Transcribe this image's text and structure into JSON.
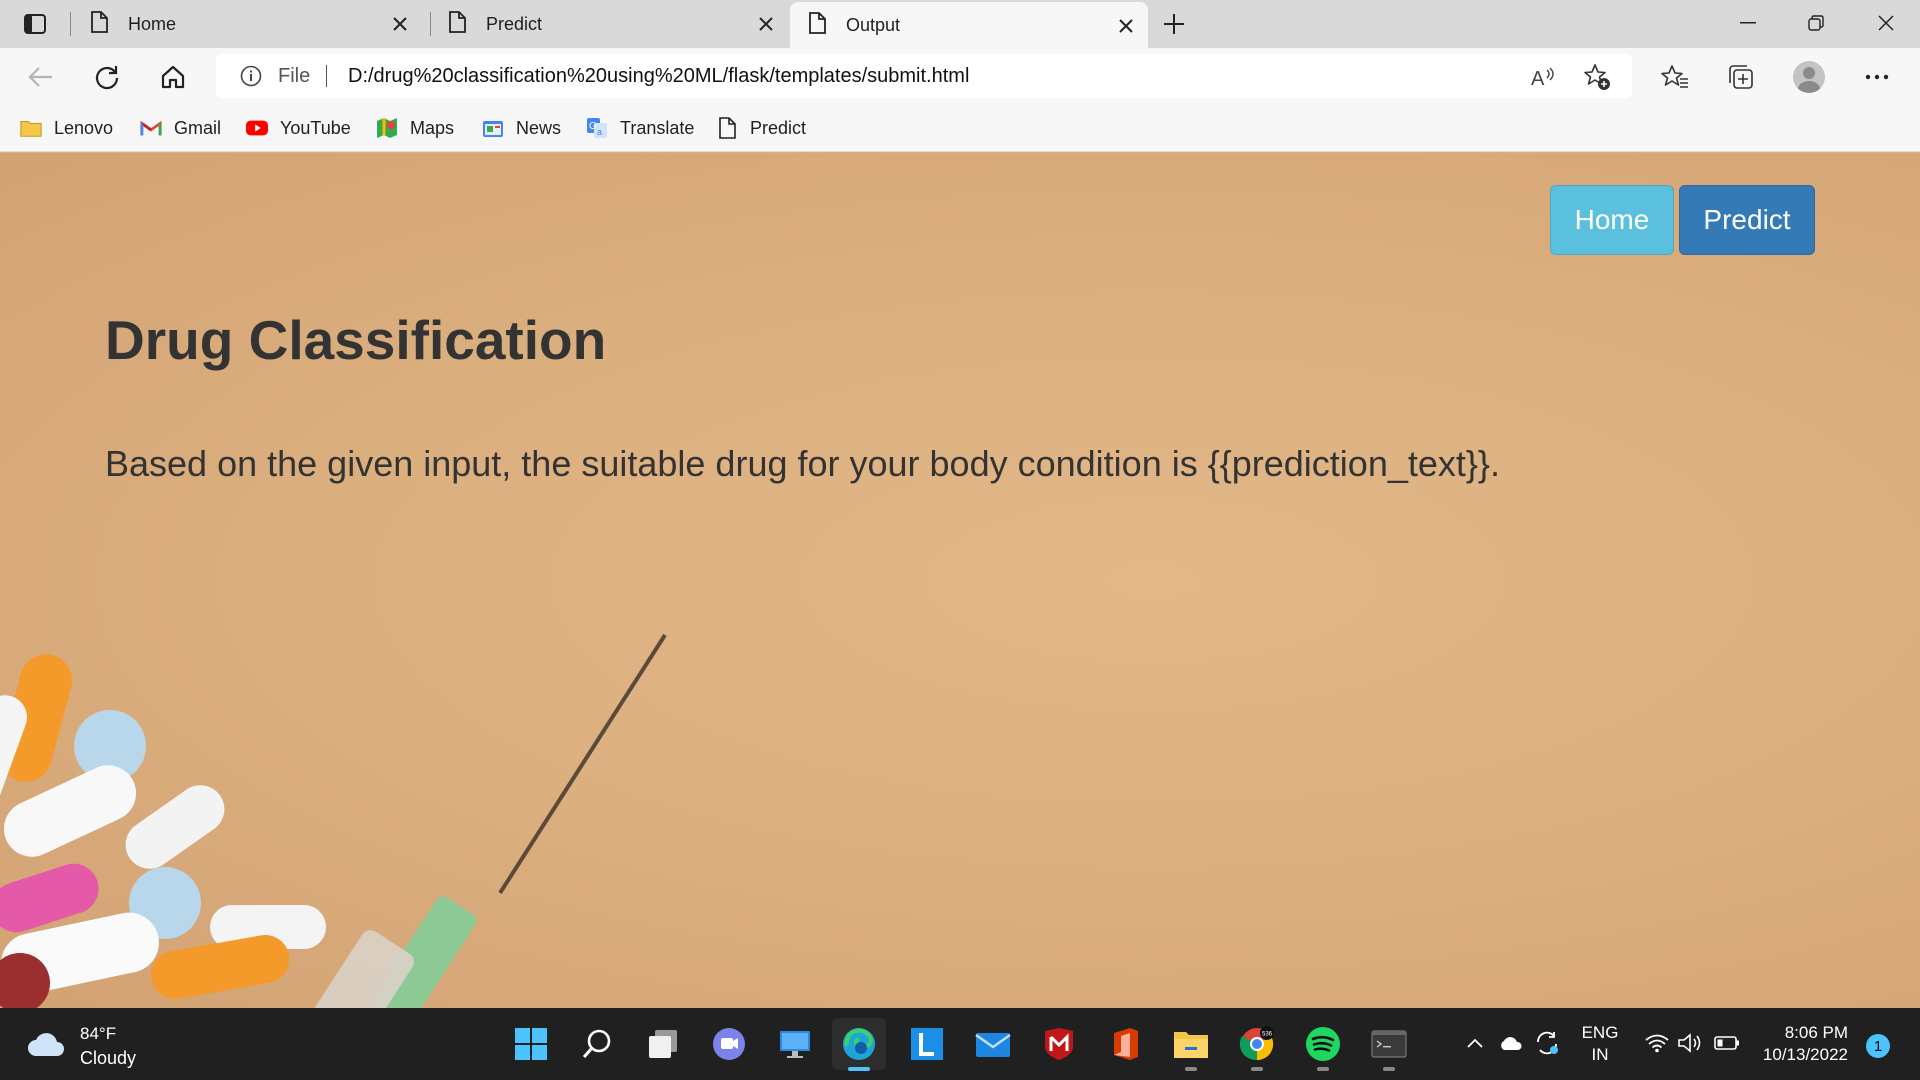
{
  "browser": {
    "tabs": [
      {
        "label": "Home",
        "active": false
      },
      {
        "label": "Predict",
        "active": false
      },
      {
        "label": "Output",
        "active": true
      }
    ],
    "address": {
      "scheme_label": "File",
      "url": "D:/drug%20classification%20using%20ML/flask/templates/submit.html"
    },
    "bookmarks": [
      {
        "label": "Lenovo",
        "icon": "folder-icon"
      },
      {
        "label": "Gmail",
        "icon": "gmail-icon"
      },
      {
        "label": "YouTube",
        "icon": "youtube-icon"
      },
      {
        "label": "Maps",
        "icon": "maps-icon"
      },
      {
        "label": "News",
        "icon": "news-icon"
      },
      {
        "label": "Translate",
        "icon": "translate-icon"
      },
      {
        "label": "Predict",
        "icon": "page-icon"
      }
    ]
  },
  "page": {
    "nav": {
      "home_label": "Home",
      "predict_label": "Predict"
    },
    "title": "Drug Classification",
    "result_text": "Based on the given input, the suitable drug for your body condition is {{prediction_text}}.",
    "colors": {
      "background": "#dbae7e",
      "home_button": "#5bc0de",
      "predict_button": "#337ab7",
      "text": "#333333"
    }
  },
  "taskbar": {
    "weather": {
      "temp": "84°F",
      "condition": "Cloudy"
    },
    "apps": [
      "start-icon",
      "search-icon",
      "task-view-icon",
      "teams-chat-icon",
      "remote-desktop-icon",
      "edge-icon",
      "lenovo-vantage-icon",
      "mail-icon",
      "mcafee-icon",
      "office-icon",
      "file-explorer-icon",
      "chrome-icon",
      "spotify-icon",
      "terminal-icon"
    ],
    "chrome_badge": "536",
    "language": {
      "line1": "ENG",
      "line2": "IN"
    },
    "clock": {
      "time": "8:06 PM",
      "date": "10/13/2022"
    },
    "notification_count": "1"
  }
}
